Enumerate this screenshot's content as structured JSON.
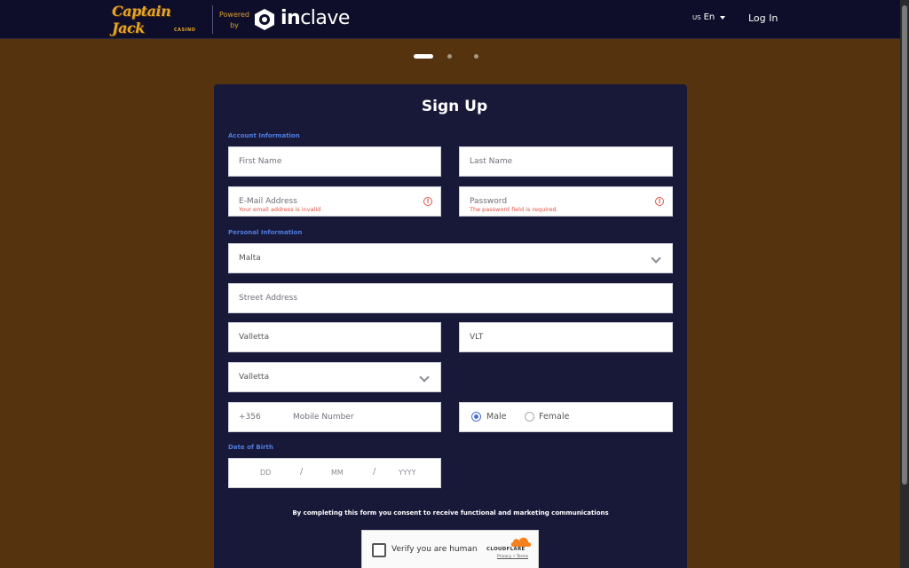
{
  "header": {
    "brand_logo_text": "Captain Jack",
    "brand_logo_subtext": "CASINO",
    "powered_by_line1": "Powered",
    "powered_by_line2": "by",
    "partner_name_prefix": "in",
    "partner_name_suffix": "clave",
    "language_flag": "US",
    "language_label": "En",
    "login_label": "Log In"
  },
  "stepper": {
    "total_steps": 3,
    "current_step": 1
  },
  "form": {
    "title": "Sign Up",
    "sections": {
      "account": "Account Information",
      "personal": "Personal Information",
      "dob": "Date of Birth"
    },
    "fields": {
      "first_name": {
        "placeholder": "First Name",
        "value": ""
      },
      "last_name": {
        "placeholder": "Last Name",
        "value": ""
      },
      "email": {
        "placeholder": "E-Mail Address",
        "value": "",
        "error": "Your email address is invalid"
      },
      "password": {
        "placeholder": "Password",
        "value": "",
        "error": "The password field is required."
      },
      "country": {
        "value": "Malta"
      },
      "street": {
        "placeholder": "Street Address",
        "value": ""
      },
      "city": {
        "value": "Valletta"
      },
      "postal": {
        "value": "VLT"
      },
      "region": {
        "value": "Valletta"
      },
      "phone_prefix": "+356",
      "phone": {
        "placeholder": "Mobile Number",
        "value": ""
      },
      "gender": {
        "options": [
          "Male",
          "Female"
        ],
        "selected": "Male"
      },
      "dob": {
        "day_placeholder": "DD",
        "month_placeholder": "MM",
        "year_placeholder": "YYYY",
        "separator": "/"
      }
    },
    "consent_text": "By completing this form you consent to receive functional and marketing communications"
  },
  "captcha": {
    "label": "Verify you are human",
    "provider": "CLOUDFLARE",
    "links": "Privacy • Terms"
  },
  "colors": {
    "page_background": "#55330f",
    "topbar": "#0e0e2a",
    "card": "#181839",
    "section_label": "#4f7de0",
    "error": "#e05040",
    "brand_gold": "#e3a52a"
  }
}
